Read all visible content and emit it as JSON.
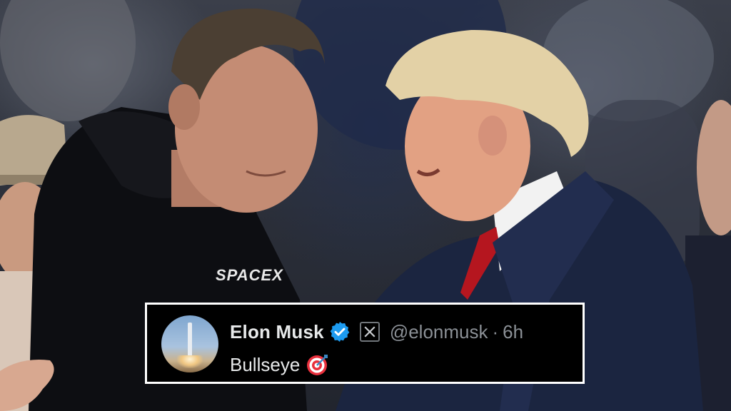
{
  "tweet": {
    "display_name": "Elon Musk",
    "handle": "@elonmusk",
    "separator": "·",
    "timestamp": "6h",
    "text": "Bullseye",
    "icons": {
      "verified": "verified-badge-icon",
      "platform": "x-logo-icon",
      "emoji": "direct-hit-target-icon"
    }
  },
  "photo": {
    "shirt_print": "SPACEX"
  },
  "colors": {
    "card_background": "#000000",
    "card_border": "#ffffff",
    "name_text": "#e7e9ea",
    "secondary_text": "#8b9096",
    "verified_blue": "#1d9bf0"
  }
}
